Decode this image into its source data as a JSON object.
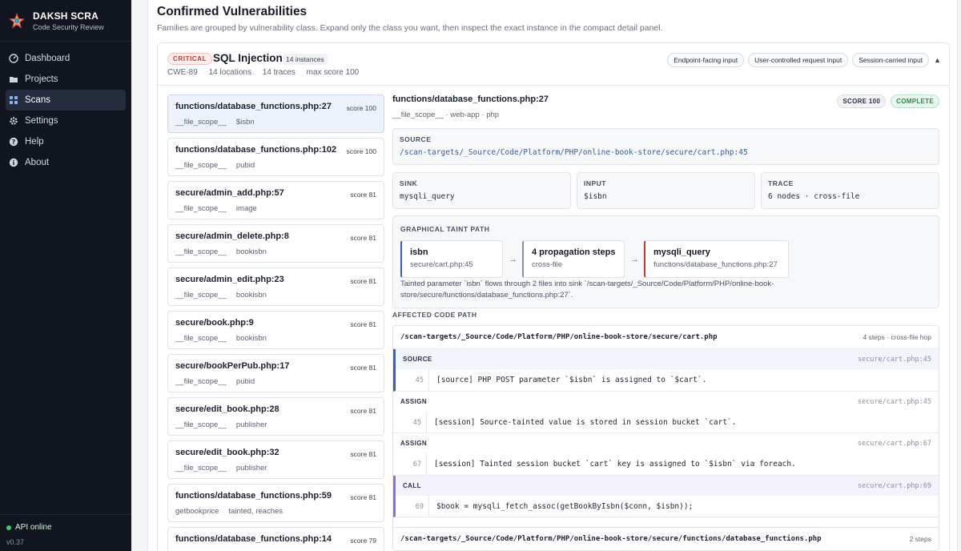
{
  "app": {
    "name": "DAKSH SCRA",
    "subtitle": "Code Security Review",
    "status": "API online",
    "version": "v0.37"
  },
  "nav": [
    {
      "label": "Dashboard",
      "icon": "dashboard-icon"
    },
    {
      "label": "Projects",
      "icon": "folder-icon"
    },
    {
      "label": "Scans",
      "icon": "grid-icon",
      "active": true
    },
    {
      "label": "Settings",
      "icon": "gear-icon"
    },
    {
      "label": "Help",
      "icon": "help-icon"
    },
    {
      "label": "About",
      "icon": "info-icon"
    }
  ],
  "page": {
    "title": "Confirmed Vulnerabilities",
    "subtitle": "Families are grouped by vulnerability class. Expand only the class you want, then inspect the exact instance in the compact detail panel."
  },
  "family": {
    "severity": "CRITICAL",
    "name": "SQL Injection",
    "instances": "14 instances",
    "cwe": "CWE-89",
    "locations": "14 locations",
    "traces": "14 traces",
    "max_score": "max score 100",
    "tags": [
      "Endpoint-facing input",
      "User-controlled request input",
      "Session-carried input"
    ],
    "caret": "▲"
  },
  "instances": [
    {
      "title": "functions/database_functions.php:27",
      "score": "score 100",
      "scope": "__file_scope__",
      "var": "$isbn",
      "selected": true
    },
    {
      "title": "functions/database_functions.php:102",
      "score": "score 100",
      "scope": "__file_scope__",
      "var": "pubid"
    },
    {
      "title": "secure/admin_add.php:57",
      "score": "score 81",
      "scope": "__file_scope__",
      "var": "image"
    },
    {
      "title": "secure/admin_delete.php:8",
      "score": "score 81",
      "scope": "__file_scope__",
      "var": "bookisbn"
    },
    {
      "title": "secure/admin_edit.php:23",
      "score": "score 81",
      "scope": "__file_scope__",
      "var": "bookisbn"
    },
    {
      "title": "secure/book.php:9",
      "score": "score 81",
      "scope": "__file_scope__",
      "var": "bookisbn"
    },
    {
      "title": "secure/bookPerPub.php:17",
      "score": "score 81",
      "scope": "__file_scope__",
      "var": "pubid"
    },
    {
      "title": "secure/edit_book.php:28",
      "score": "score 81",
      "scope": "__file_scope__",
      "var": "publisher"
    },
    {
      "title": "secure/edit_book.php:32",
      "score": "score 81",
      "scope": "__file_scope__",
      "var": "publisher"
    },
    {
      "title": "functions/database_functions.php:59",
      "score": "score 81",
      "scope": "getbookprice",
      "var": "tainted, reaches"
    },
    {
      "title": "functions/database_functions.php:14",
      "score": "score 79",
      "scope": "",
      "var": ""
    }
  ],
  "detail": {
    "title": "functions/database_functions.php:27",
    "subtitle": "__file_scope__ · web-app · php",
    "score_badge": "SCORE 100",
    "status_badge": "COMPLETE",
    "source_label": "SOURCE",
    "source_value": "/scan-targets/_Source/Code/Platform/PHP/online-book-store/secure/cart.php:45",
    "sink_label": "SINK",
    "sink_value": "mysqli_query",
    "input_label": "INPUT",
    "input_value": "$isbn",
    "trace_label": "TRACE",
    "trace_value": "6 nodes · cross-file",
    "graph_label": "GRAPHICAL TAINT PATH",
    "nodes": [
      {
        "title": "isbn",
        "sub": "secure/cart.php:45"
      },
      {
        "title": "4 propagation steps",
        "sub": "cross-file"
      },
      {
        "title": "mysqli_query",
        "sub": "functions/database_functions.php:27"
      }
    ],
    "arrow": "→",
    "graph_desc": "Tainted parameter `isbn` flows through 2 files into sink `/scan-targets/_Source/Code/Platform/PHP/online-book-store/secure/functions/database_functions.php:27`.",
    "affected_label": "AFFECTED CODE PATH",
    "files": [
      {
        "path": "/scan-targets/_Source/Code/Platform/PHP/online-book-store/secure/cart.php",
        "meta": "4 steps · cross-file hop",
        "steps": [
          {
            "kind": "SOURCE",
            "loc": "secure/cart.php:45",
            "line": "45",
            "code": "[source] PHP POST parameter `$isbn` is assigned to `$cart`."
          },
          {
            "kind": "ASSIGN",
            "loc": "secure/cart.php:45",
            "line": "45",
            "code": "[session] Source-tainted value is stored in session bucket `cart`."
          },
          {
            "kind": "ASSIGN",
            "loc": "secure/cart.php:67",
            "line": "67",
            "code": "[session] Tainted session bucket `cart` key is assigned to `$isbn` via foreach."
          },
          {
            "kind": "CALL",
            "loc": "secure/cart.php:69",
            "line": "69",
            "code": "$book = mysqli_fetch_assoc(getBookByIsbn($conn, $isbn));"
          }
        ]
      },
      {
        "path": "/scan-targets/_Source/Code/Platform/PHP/online-book-store/secure/functions/database_functions.php",
        "meta": "2 steps"
      }
    ]
  },
  "colors": {
    "sidebar": "#111520",
    "critical": "#c0392b",
    "source_bar": "#3b5fb8",
    "call_bar": "#8b6fd6",
    "sink_bar": "#c0392b",
    "ok": "#2b8a48"
  }
}
